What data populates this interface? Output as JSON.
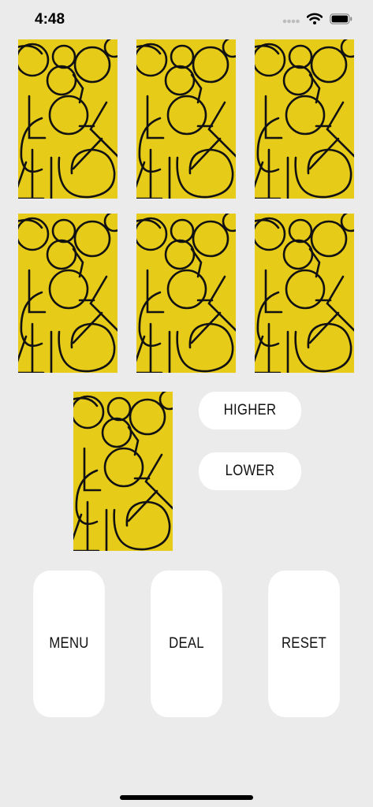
{
  "status": {
    "time": "4:48"
  },
  "card_back": {
    "background": "#e7cb19",
    "stroke": "#111111"
  },
  "cards": {
    "grid": [
      {
        "name": "card-back-1"
      },
      {
        "name": "card-back-2"
      },
      {
        "name": "card-back-3"
      },
      {
        "name": "card-back-4"
      },
      {
        "name": "card-back-5"
      },
      {
        "name": "card-back-6"
      }
    ],
    "current": {
      "name": "current-card"
    }
  },
  "guess": {
    "higher_label": "HIGHER",
    "lower_label": "LOWER"
  },
  "controls": {
    "menu_label": "MENU",
    "deal_label": "DEAL",
    "reset_label": "RESET"
  }
}
